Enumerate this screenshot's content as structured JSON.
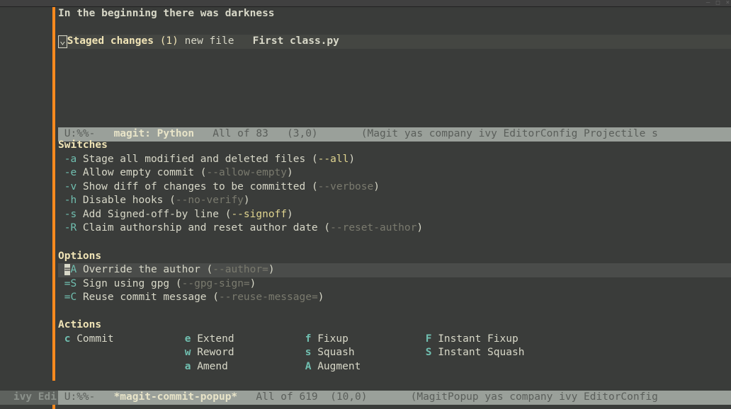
{
  "titlebar": {
    "min": "–",
    "max": "□",
    "close": "×"
  },
  "magit": {
    "first_line": "In the beginning there was darkness",
    "staged_heading": "Staged changes",
    "staged_count": "(1)",
    "staged_file_prefix": "new file   ",
    "staged_file": "First class.py",
    "caret": "⌄"
  },
  "ml1": {
    "pre": " U:%%- ",
    "buf": "  magit: Python  ",
    "pos": " All of 83   (3,0)       ",
    "modes": "(Magit yas company ivy EditorConfig Projectile s"
  },
  "popup": {
    "hdr_switches": "Switches",
    "switches": [
      {
        "k": " -a ",
        "d": "Stage all modified and deleted files ",
        "o": "(",
        "f": "--all",
        "c": ")",
        "on": true
      },
      {
        "k": " -e ",
        "d": "Allow empty commit ",
        "o": "(",
        "f": "--allow-empty",
        "c": ")",
        "on": false
      },
      {
        "k": " -v ",
        "d": "Show diff of changes to be committed ",
        "o": "(",
        "f": "--verbose",
        "c": ")",
        "on": false
      },
      {
        "k": " -h ",
        "d": "Disable hooks ",
        "o": "(",
        "f": "--no-verify",
        "c": ")",
        "on": false
      },
      {
        "k": " -s ",
        "d": "Add Signed-off-by line ",
        "o": "(",
        "f": "--signoff",
        "c": ")",
        "on": true
      },
      {
        "k": " -R ",
        "d": "Claim authorship and reset author date ",
        "o": "(",
        "f": "--reset-author",
        "c": ")",
        "on": false
      }
    ],
    "hdr_options": "Options",
    "options": [
      {
        "k": "=A ",
        "d": "Override the author ",
        "o": "(",
        "f": "--author=",
        "c": ")",
        "hl": true
      },
      {
        "k": "=S ",
        "d": "Sign using gpg ",
        "o": "(",
        "f": "--gpg-sign=",
        "c": ")",
        "hl": false
      },
      {
        "k": "=C ",
        "d": "Reuse commit message ",
        "o": "(",
        "f": "--reuse-message=",
        "c": ")",
        "hl": false
      }
    ],
    "hdr_actions": "Actions",
    "actions_row1": [
      {
        "k": " c ",
        "l": "Commit"
      },
      {
        "k": " e ",
        "l": "Extend"
      },
      {
        "k": " f ",
        "l": "Fixup"
      },
      {
        "k": " F ",
        "l": "Instant Fixup"
      }
    ],
    "actions_row2": [
      {
        "k": "",
        "l": ""
      },
      {
        "k": " w ",
        "l": "Reword"
      },
      {
        "k": " s ",
        "l": "Squash"
      },
      {
        "k": " S ",
        "l": "Instant Squash"
      }
    ],
    "actions_row3": [
      {
        "k": "",
        "l": ""
      },
      {
        "k": " a ",
        "l": "Amend"
      },
      {
        "k": " A ",
        "l": "Augment"
      },
      {
        "k": "",
        "l": ""
      }
    ]
  },
  "ml2": {
    "left_frag": " ivy Edi",
    "pre": " U:%%- ",
    "buf": "  *magit-commit-popup*  ",
    "pos": " All of 619  (10,0)       ",
    "modes": "(MagitPopup yas company ivy EditorConfig "
  }
}
